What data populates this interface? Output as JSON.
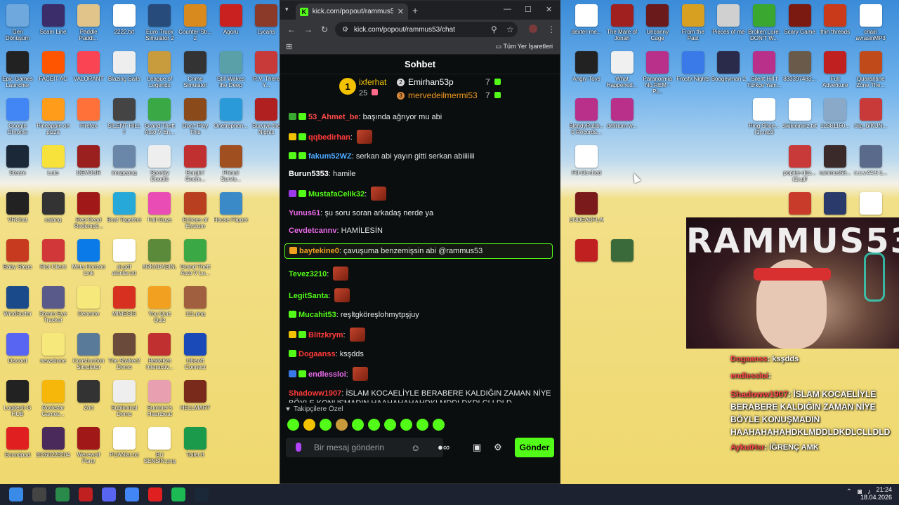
{
  "desktop": {
    "left_icons": [
      {
        "label": "Geri Dönüşüm",
        "icon": "recycle-bin-icon",
        "color": "#6fa8dc"
      },
      {
        "label": "Scam Line",
        "icon": "game-icon",
        "color": "#3a2d6a"
      },
      {
        "label": "Paddle Paddl...",
        "icon": "game-icon",
        "color": "#e0c48a"
      },
      {
        "label": "2222.txt",
        "icon": "text-file-icon",
        "color": "#ffffff"
      },
      {
        "label": "Euro Truck Simulator 2",
        "icon": "game-icon",
        "color": "#274b7a"
      },
      {
        "label": "Counter-Str... 2",
        "icon": "game-icon",
        "color": "#d98a1f"
      },
      {
        "label": "Agoru",
        "icon": "game-icon",
        "color": "#c92020"
      },
      {
        "label": "Lycans",
        "icon": "game-icon",
        "color": "#8b3a2a"
      },
      {
        "label": "Epic Games Launcher",
        "icon": "epic-games-icon",
        "color": "#222222"
      },
      {
        "label": "FACEIT AC",
        "icon": "faceit-icon",
        "color": "#ff5500"
      },
      {
        "label": "VALORANT",
        "icon": "valorant-icon",
        "color": "#fa4454"
      },
      {
        "label": "Blazing Sails",
        "icon": "game-icon",
        "color": "#eeeeee"
      },
      {
        "label": "League of Legends",
        "icon": "game-icon",
        "color": "#c89b3c"
      },
      {
        "label": "Crime Simulator",
        "icon": "game-icon",
        "color": "#333333"
      },
      {
        "label": "Still Wakes the Deep",
        "icon": "game-icon",
        "color": "#5aa0a8"
      },
      {
        "label": "R.V. There Y...",
        "icon": "game-icon",
        "color": "#c83a3a"
      },
      {
        "label": "Google Chrome",
        "icon": "chrome-icon",
        "color": "#4285f4"
      },
      {
        "label": "Pineapple on pizza",
        "icon": "game-icon",
        "color": "#ff9c1a"
      },
      {
        "label": "Firefox",
        "icon": "firefox-icon",
        "color": "#ff7139"
      },
      {
        "label": "SILENT HILL f",
        "icon": "game-icon",
        "color": "#444444"
      },
      {
        "label": "Grand Theft Auto V En...",
        "icon": "gta-icon",
        "color": "#3aa845"
      },
      {
        "label": "Don't Play This",
        "icon": "game-icon",
        "color": "#8a4a1a"
      },
      {
        "label": "Onetrophon...",
        "icon": "game-icon",
        "color": "#2a9ad8"
      },
      {
        "label": "Survive the Nights",
        "icon": "game-icon",
        "color": "#b02020"
      },
      {
        "label": "Steam",
        "icon": "steam-icon",
        "color": "#1b2838"
      },
      {
        "label": "Luto",
        "icon": "game-icon",
        "color": "#f6e23a"
      },
      {
        "label": "DEVOUR",
        "icon": "game-icon",
        "color": "#9a2020"
      },
      {
        "label": "imagepng",
        "icon": "image-icon",
        "color": "#6a86a8"
      },
      {
        "label": "Spooky Doodle",
        "icon": "game-icon",
        "color": "#eeeeee"
      },
      {
        "label": "Burglin' Gnom...",
        "icon": "game-icon",
        "color": "#c03030"
      },
      {
        "label": "Primal Surviv...",
        "icon": "game-icon",
        "color": "#a05020"
      },
      {
        "label": "",
        "icon": "blank-icon",
        "color": "transparent"
      },
      {
        "label": "VRChat",
        "icon": "vrchat-icon",
        "color": "#222222"
      },
      {
        "label": "saipng",
        "icon": "image-icon",
        "color": "#333333"
      },
      {
        "label": "Red Dead Redempti...",
        "icon": "game-icon",
        "color": "#a01818"
      },
      {
        "label": "Boat Together",
        "icon": "game-icon",
        "color": "#26a8d8"
      },
      {
        "label": "Fall Guys",
        "icon": "game-icon",
        "color": "#e94cb4"
      },
      {
        "label": "Echoes of Elysium",
        "icon": "game-icon",
        "color": "#b84020"
      },
      {
        "label": "House Flipper",
        "icon": "game-icon",
        "color": "#3a8ac8"
      },
      {
        "label": "",
        "icon": "blank-icon",
        "color": "transparent"
      },
      {
        "label": "Baby Steps",
        "icon": "game-icon",
        "color": "#c83a20"
      },
      {
        "label": "Riot Client",
        "icon": "riot-icon",
        "color": "#d13639"
      },
      {
        "label": "Meta Horizon Link",
        "icon": "meta-icon",
        "color": "#0a7ae8"
      },
      {
        "label": "pi.pdf alanlar.txt",
        "icon": "text-file-icon",
        "color": "#ffffff"
      },
      {
        "label": "ARKADAŞIN...",
        "icon": "image-icon",
        "color": "#5a8a3a"
      },
      {
        "label": "Grand Theft Auto V Le...",
        "icon": "gta-icon",
        "color": "#3aa845"
      },
      {
        "label": "",
        "icon": "blank-icon",
        "color": "transparent"
      },
      {
        "label": "",
        "icon": "blank-icon",
        "color": "transparent"
      },
      {
        "label": "WindSurfer",
        "icon": "game-icon",
        "color": "#1a4a8a"
      },
      {
        "label": "Steam Eye Tracker",
        "icon": "game-icon",
        "color": "#5a5a8a"
      },
      {
        "label": "Deneme",
        "icon": "text-file-icon",
        "color": "#f6e87a"
      },
      {
        "label": "MIMESIS",
        "icon": "game-icon",
        "color": "#d83020"
      },
      {
        "label": "You Quiz Quiz",
        "icon": "game-icon",
        "color": "#f2a020"
      },
      {
        "label": "111.png",
        "icon": "image-icon",
        "color": "#a06040"
      },
      {
        "label": "",
        "icon": "blank-icon",
        "color": "transparent"
      },
      {
        "label": "",
        "icon": "blank-icon",
        "color": "transparent"
      },
      {
        "label": "Discord",
        "icon": "discord-icon",
        "color": "#5865f2"
      },
      {
        "label": "newsbone",
        "icon": "text-file-icon",
        "color": "#f6e87a"
      },
      {
        "label": "Construction Simulator",
        "icon": "game-icon",
        "color": "#5a7a9a"
      },
      {
        "label": "The Stalker2 Demo",
        "icon": "game-icon",
        "color": "#6a4a3a"
      },
      {
        "label": "BekleKet Interactiv...",
        "icon": "game-icon",
        "color": "#c03030"
      },
      {
        "label": "Ubisoft Connect",
        "icon": "ubisoft-icon",
        "color": "#1a4ab8"
      },
      {
        "label": "",
        "icon": "blank-icon",
        "color": "transparent"
      },
      {
        "label": "",
        "icon": "blank-icon",
        "color": "transparent"
      },
      {
        "label": "Logitech G HUB",
        "icon": "logitech-icon",
        "color": "#222222"
      },
      {
        "label": "Rockstar Games...",
        "icon": "rockstar-icon",
        "color": "#f6b70a"
      },
      {
        "label": "Zort",
        "icon": "game-icon",
        "color": "#333333"
      },
      {
        "label": "Subliminal Demo",
        "icon": "game-icon",
        "color": "#eeeeee"
      },
      {
        "label": "Summer's Heartbeat",
        "icon": "game-icon",
        "color": "#e8a0b0"
      },
      {
        "label": "HELLMART",
        "icon": "game-icon",
        "color": "#7a2a1a"
      },
      {
        "label": "",
        "icon": "blank-icon",
        "color": "transparent"
      },
      {
        "label": "",
        "icon": "blank-icon",
        "color": "transparent"
      },
      {
        "label": "Soundpad",
        "icon": "soundpad-icon",
        "color": "#e02020"
      },
      {
        "label": "20260228204...",
        "icon": "image-icon",
        "color": "#4a2a5a"
      },
      {
        "label": "Werewolf Party",
        "icon": "game-icon",
        "color": "#a01818"
      },
      {
        "label": "PUANlar.txt",
        "icon": "text-file-icon",
        "color": "#ffffff"
      },
      {
        "label": "BU SENSIN.png",
        "icon": "image-icon",
        "color": "#ffffff"
      },
      {
        "label": "Toilet 8",
        "icon": "game-icon",
        "color": "#1a9a4a"
      }
    ],
    "right_icons": [
      {
        "label": "dexter-me...",
        "icon": "media-file-icon",
        "color": "#ffffff"
      },
      {
        "label": "The Mare of Jonah",
        "icon": "game-icon",
        "color": "#a02020"
      },
      {
        "label": "Uncanny Cage",
        "icon": "game-icon",
        "color": "#6a1a1a"
      },
      {
        "label": "From the Past",
        "icon": "game-icon",
        "color": "#d8a020"
      },
      {
        "label": "Pieces of me",
        "icon": "game-icon",
        "color": "#d0d0d0"
      },
      {
        "label": "Broken Lore: DON'T W...",
        "icon": "game-icon",
        "color": "#3aa830"
      },
      {
        "label": "Scary Game",
        "icon": "game-icon",
        "color": "#7a1a10"
      },
      {
        "label": "thin threads",
        "icon": "game-icon",
        "color": "#c83a1a"
      },
      {
        "label": "chain avrasinMP3",
        "icon": "media-file-icon",
        "color": "#ffffff"
      },
      {
        "label": "Angry Toys",
        "icon": "game-icon",
        "color": "#222222"
      },
      {
        "label": "What Happened...",
        "icon": "game-icon",
        "color": "#f0f0f0"
      },
      {
        "label": "Paranormia No REM - Pr...",
        "icon": "archive-icon",
        "color": "#b8308a"
      },
      {
        "label": "Frosty Nights",
        "icon": "game-icon",
        "color": "#3a7ae8"
      },
      {
        "label": "Boogeyman 2",
        "icon": "game-icon",
        "color": "#2a2a4a"
      },
      {
        "label": "Silent Hill f Türkçe Yam...",
        "icon": "archive-icon",
        "color": "#b8308a"
      },
      {
        "label": "833397483...",
        "icon": "image-icon",
        "color": "#6a5a4a"
      },
      {
        "label": "Full Adventure",
        "icon": "game-icon",
        "color": "#c02020"
      },
      {
        "label": "Quarantine Zone The...",
        "icon": "game-icon",
        "color": "#c04a1a"
      },
      {
        "label": "SlendyRubb... 0 Records...",
        "icon": "archive-icon",
        "color": "#b8308a"
      },
      {
        "label": "delirium-w...",
        "icon": "archive-icon",
        "color": "#b8308a"
      },
      {
        "label": "",
        "icon": "blank-icon",
        "color": "transparent"
      },
      {
        "label": "",
        "icon": "blank-icon",
        "color": "transparent"
      },
      {
        "label": "",
        "icon": "blank-icon",
        "color": "transparent"
      },
      {
        "label": "Ping Shoe... (1).mp3",
        "icon": "media-file-icon",
        "color": "#ffffff"
      },
      {
        "label": "sikikleiniriz.txt",
        "icon": "text-file-icon",
        "color": "#ffffff"
      },
      {
        "label": "12381160...",
        "icon": "image-icon",
        "color": "#8aa8c8"
      },
      {
        "label": "clip_b/KUN...",
        "icon": "image-icon",
        "color": "#c83a3a"
      },
      {
        "label": "Fill-Oo-thed",
        "icon": "game-icon",
        "color": "#ffffff"
      },
      {
        "label": "",
        "icon": "blank-icon",
        "color": "transparent"
      },
      {
        "label": "",
        "icon": "blank-icon",
        "color": "transparent"
      },
      {
        "label": "",
        "icon": "blank-icon",
        "color": "transparent"
      },
      {
        "label": "",
        "icon": "blank-icon",
        "color": "transparent"
      },
      {
        "label": "",
        "icon": "blank-icon",
        "color": "transparent"
      },
      {
        "label": "popiler-düz... (1).gif",
        "icon": "image-icon",
        "color": "#c83a3a"
      },
      {
        "label": "rammus53...",
        "icon": "image-icon",
        "color": "#3a2a2a"
      },
      {
        "label": "c.c.v.44.5 1...",
        "icon": "image-icon",
        "color": "#5a6a8a"
      },
      {
        "label": "UNDEADFLAG",
        "icon": "image-icon",
        "color": "#7a1a1a"
      },
      {
        "label": "",
        "icon": "blank-icon",
        "color": "transparent"
      },
      {
        "label": "",
        "icon": "blank-icon",
        "color": "transparent"
      },
      {
        "label": "",
        "icon": "blank-icon",
        "color": "transparent"
      },
      {
        "label": "",
        "icon": "blank-icon",
        "color": "transparent"
      },
      {
        "label": "",
        "icon": "blank-icon",
        "color": "transparent"
      },
      {
        "label": "",
        "icon": "image-icon",
        "color": "#c83a2a"
      },
      {
        "label": "",
        "icon": "image-icon",
        "color": "#2a3a6a"
      },
      {
        "label": "",
        "icon": "media-file-icon",
        "color": "#ffffff"
      },
      {
        "label": "",
        "icon": "image-icon",
        "color": "#c02020"
      },
      {
        "label": "",
        "icon": "image-icon",
        "color": "#3a6a3a"
      }
    ]
  },
  "browser": {
    "tab_title": "kick.com/popout/rammus53/cl",
    "url": "kick.com/popout/rammus53/chat",
    "bookmarks_label": "Tüm Yer İşaretleri"
  },
  "chat": {
    "header_title": "Sohbet",
    "leaderboard": {
      "first": {
        "rank": "1",
        "name": "ixferhat",
        "score": "25"
      },
      "second": {
        "name": "Emirhan53p",
        "score": "7"
      },
      "third": {
        "name": "mervedeilmermi53",
        "score": "7"
      }
    },
    "messages": [
      {
        "user": "53_Ahmet_be",
        "color": "#ff4a4a",
        "badges": [
          "#3aa830",
          "#53fc18"
        ],
        "text": ": başında ağrıyor mu abi",
        "emote": false,
        "highlight": false
      },
      {
        "user": "qqbedirhan",
        "color": "#ff3a3a",
        "badges": [
          "#f2c200",
          "#53fc18"
        ],
        "text": ":",
        "emote": true,
        "highlight": false
      },
      {
        "user": "fakum52WZ",
        "color": "#4aa8ff",
        "badges": [
          "#53fc18",
          "#53fc18"
        ],
        "text": ": serkan abi yayın gitti serkan abiiiiiii",
        "emote": false,
        "highlight": false
      },
      {
        "user": "Burun5353",
        "color": "#ffffff",
        "badges": [],
        "text": ": hamile",
        "emote": false,
        "highlight": false
      },
      {
        "user": "MustafaCelik32",
        "color": "#53fc18",
        "badges": [
          "#9a3ae8",
          "#53fc18"
        ],
        "text": ":",
        "emote": true,
        "highlight": false
      },
      {
        "user": "Yunus61",
        "color": "#e86ae8",
        "badges": [],
        "text": ": şu soru soran arkadaş nerde ya",
        "emote": false,
        "highlight": false
      },
      {
        "user": "Cevdetcannv",
        "color": "#e86ae8",
        "badges": [],
        "text": ": HAMİLESİN",
        "emote": false,
        "highlight": false
      },
      {
        "user": "baytekine0",
        "color": "#f2a020",
        "badges": [
          "#f2a020"
        ],
        "text": ": çavuşuma benzemişsin abi @rammus53",
        "emote": false,
        "highlight": true
      },
      {
        "user": "Tevez3210",
        "color": "#53fc18",
        "badges": [],
        "text": ":",
        "emote": true,
        "highlight": false
      },
      {
        "user": "LegitSanta",
        "color": "#53fc18",
        "badges": [],
        "text": ":",
        "emote": true,
        "highlight": false
      },
      {
        "user": "Mucahit53",
        "color": "#53fc18",
        "badges": [
          "#53fc18"
        ],
        "text": ": reşltgköreşlohmytpşjuy",
        "emote": false,
        "highlight": false
      },
      {
        "user": "Blitzkrym",
        "color": "#ff3a3a",
        "badges": [
          "#f2c200",
          "#53fc18"
        ],
        "text": ":",
        "emote": true,
        "highlight": false
      },
      {
        "user": "Dogaanss",
        "color": "#ff3a3a",
        "badges": [
          "#53fc18"
        ],
        "text": ": ksşdds",
        "emote": false,
        "highlight": false
      },
      {
        "user": "endlessloi",
        "color": "#e86ae8",
        "badges": [
          "#3a7ae8",
          "#53fc18"
        ],
        "text": ":",
        "emote": true,
        "highlight": false
      },
      {
        "user": "Shadoww1907",
        "color": "#ff3a3a",
        "badges": [],
        "text": ": İSLAM KOCAELİYLE BERABERE KALDIĞIN ZAMAN NİYE BÖYLE KONUŞMADIN HAAHAHAHAHDKLMDDLDKDLCLLDLD",
        "emote": false,
        "highlight": false
      },
      {
        "user": "AykutHsr",
        "color": "#e86ae8",
        "badges": [
          "#3a7ae8",
          "#53fc18",
          "#ff6a8a"
        ],
        "text": ": İĞRENÇ AMK",
        "emote": false,
        "highlight": false
      }
    ],
    "followers_label": "Takipçilere Özel",
    "input_placeholder": "Bir mesaj gönderin",
    "send_label": "Gönder"
  },
  "stream_overlay": {
    "banner_text": "RAMMUS53",
    "overlay_messages": [
      {
        "user": "Dogaanss",
        "text": ": ksşdds"
      },
      {
        "user": "endlessloi",
        "text": ":"
      },
      {
        "user": "Shadoww1907",
        "text": ": İSLAM KOCAELİYLE BERABERE KALDIĞIN ZAMAN NİYE BÖYLE KONUŞMADIN HAAHAHAHAHDKLMDDLDKDLCLLDLD"
      },
      {
        "user": "AykutHsr",
        "text": ": İĞRENÇ AMK"
      }
    ]
  },
  "taskbar": {
    "items": [
      {
        "name": "start-icon",
        "color": "#3a8ae8"
      },
      {
        "name": "search-icon",
        "color": "#444444"
      },
      {
        "name": "app-icon",
        "color": "#2a8a4a"
      },
      {
        "name": "app-icon",
        "color": "#c02020"
      },
      {
        "name": "discord-icon",
        "color": "#5865f2"
      },
      {
        "name": "chrome-icon",
        "color": "#4285f4"
      },
      {
        "name": "youtube-icon",
        "color": "#e02020"
      },
      {
        "name": "spotify-icon",
        "color": "#1db954"
      },
      {
        "name": "steam-icon",
        "color": "#1b2838"
      }
    ],
    "time": "21:24",
    "date": "18.04.2026"
  }
}
